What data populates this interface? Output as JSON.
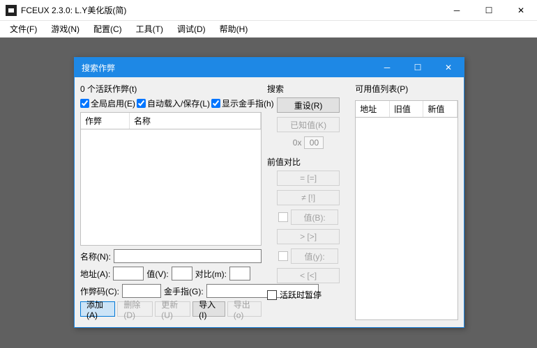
{
  "main": {
    "title": "FCEUX 2.3.0: L.Y美化版(简)",
    "menu": [
      "文件(F)",
      "游戏(N)",
      "配置(C)",
      "工具(T)",
      "调试(D)",
      "帮助(H)"
    ]
  },
  "dialog": {
    "title": "搜索作弊",
    "count_label": "0 个活跃作弊(t)",
    "chk_global": "全局启用(E)",
    "chk_autoload": "自动载入/保存(L)",
    "chk_show": "显示金手指(h)",
    "list": {
      "col_cheat": "作弊",
      "col_name": "名称"
    },
    "form": {
      "name": "名称(N):",
      "addr": "地址(A):",
      "val": "值(V):",
      "cmp": "对比(m):",
      "code": "作弊码(C):",
      "gg": "金手指(G):"
    },
    "buttons": {
      "add": "添加(A)",
      "del": "删除(D)",
      "upd": "更新(U)",
      "imp": "导入(I)",
      "exp": "导出(o)"
    },
    "search": {
      "title": "搜索",
      "reset": "重设(R)",
      "known": "已知值(K)",
      "ox_prefix": "0x",
      "ox_val": "00",
      "prev_title": "前值对比",
      "eq": "= [=]",
      "ne": "≠ [!]",
      "valB": "值(B):",
      "gt": "> [>]",
      "valY": "值(y):",
      "lt": "< [<]",
      "pause": "活跃时暂停"
    },
    "right": {
      "title": "可用值列表(P)",
      "col_addr": "地址",
      "col_old": "旧值",
      "col_new": "新值"
    }
  }
}
